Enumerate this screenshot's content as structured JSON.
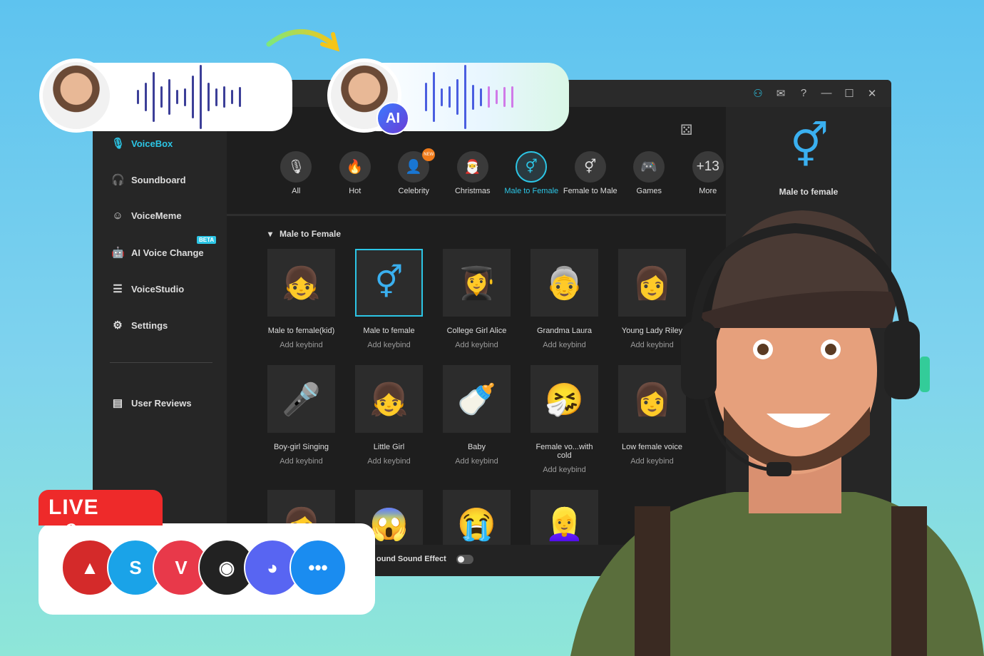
{
  "window": {
    "titlebar_icons": [
      "user-icon",
      "mail-icon",
      "help-icon",
      "minimize-icon",
      "maximize-icon",
      "close-icon"
    ]
  },
  "sidebar": {
    "items": [
      {
        "label": "VoiceBox",
        "icon": "microphone-icon",
        "active": true
      },
      {
        "label": "Soundboard",
        "icon": "headphones-icon"
      },
      {
        "label": "VoiceMeme",
        "icon": "smiley-icon"
      },
      {
        "label": "AI Voice Change",
        "icon": "robot-icon",
        "badge": "BETA"
      },
      {
        "label": "VoiceStudio",
        "icon": "sliders-icon"
      },
      {
        "label": "Settings",
        "icon": "gear-icon"
      },
      {
        "label": "User Reviews",
        "icon": "review-icon"
      }
    ]
  },
  "categories": [
    {
      "label": "All",
      "glyph": "🎙"
    },
    {
      "label": "Hot",
      "glyph": "🔥"
    },
    {
      "label": "Celebrity",
      "glyph": "👤",
      "badge": "NEW"
    },
    {
      "label": "Christmas",
      "glyph": "🎅"
    },
    {
      "label": "Male to Female",
      "glyph": "⚥",
      "active": true
    },
    {
      "label": "Female to Male",
      "glyph": "⚥"
    },
    {
      "label": "Games",
      "glyph": "🎮"
    },
    {
      "label": "More",
      "glyph": "+13"
    }
  ],
  "section_title": "Male to Female",
  "voices": [
    {
      "name": "Male to female(kid)",
      "keybind": "Add keybind",
      "glyph": "👧",
      "color": "#3ee0d8"
    },
    {
      "name": "Male to female",
      "keybind": "Add keybind",
      "glyph": "⚥",
      "color": "#3ab0f0",
      "selected": true
    },
    {
      "name": "College Girl Alice",
      "keybind": "Add keybind",
      "glyph": "👩‍🎓",
      "color": "#e07050"
    },
    {
      "name": "Grandma Laura",
      "keybind": "Add keybind",
      "glyph": "👵",
      "color": "#d03030"
    },
    {
      "name": "Young Lady Riley",
      "keybind": "Add keybind",
      "glyph": "👩",
      "color": "#e0a080"
    },
    {
      "name": "Boy-girl Singing",
      "keybind": "Add keybind",
      "glyph": "🎤",
      "color": "#2a9af0"
    },
    {
      "name": "Little Girl",
      "keybind": "Add keybind",
      "glyph": "👧",
      "color": "#3ee0d8"
    },
    {
      "name": "Baby",
      "keybind": "Add keybind",
      "glyph": "🍼",
      "color": "#b08a20"
    },
    {
      "name": "Female vo...with cold",
      "keybind": "Add keybind",
      "glyph": "🤧",
      "color": "#b040e0"
    },
    {
      "name": "Low female voice",
      "keybind": "Add keybind",
      "glyph": "👩",
      "color": "#20b0f0"
    },
    {
      "name": "",
      "keybind": "",
      "glyph": "👩",
      "color": "#b040e0"
    },
    {
      "name": "",
      "keybind": "",
      "glyph": "😱",
      "color": "#20e0d0"
    },
    {
      "name": "",
      "keybind": "",
      "glyph": "😭",
      "color": "#b040e0"
    },
    {
      "name": "",
      "keybind": "",
      "glyph": "👱‍♀️",
      "color": "#f0c020"
    }
  ],
  "bottom": {
    "sound_effect_label": "ound Sound Effect",
    "toggle_on": false
  },
  "right_panel": {
    "label": "Male to female"
  },
  "live_label": "LIVE",
  "apps": [
    {
      "name": "apex-legends-icon",
      "color": "#d42a2a",
      "glyph": "▲"
    },
    {
      "name": "skype-icon",
      "color": "#1aa3e8",
      "glyph": "S"
    },
    {
      "name": "valorant-icon",
      "color": "#e8394a",
      "glyph": "V"
    },
    {
      "name": "obs-icon",
      "color": "#222222",
      "glyph": "◉"
    },
    {
      "name": "discord-icon",
      "color": "#5865f2",
      "glyph": "◕"
    },
    {
      "name": "more-icon",
      "color": "#1a8cf0",
      "glyph": "•••"
    }
  ],
  "colors": {
    "accent": "#2cc6e6",
    "live": "#ee2a2a"
  }
}
